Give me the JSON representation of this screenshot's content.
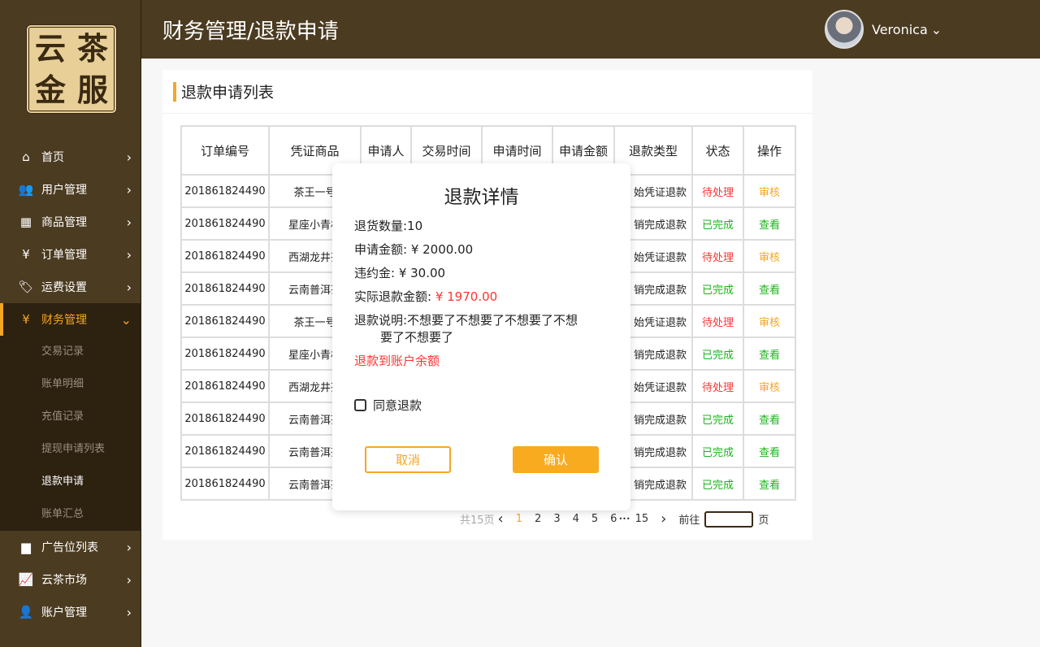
{
  "header": {
    "title": "财务管理/退款申请",
    "user": "Veronica"
  },
  "logo": [
    "云",
    "茶",
    "金",
    "服"
  ],
  "sidebar": {
    "items": [
      {
        "label": "首页",
        "icon": "home-icon",
        "glyph": "⌂"
      },
      {
        "label": "用户管理",
        "icon": "users-icon",
        "glyph": "👥"
      },
      {
        "label": "商品管理",
        "icon": "grid-icon",
        "glyph": "▦"
      },
      {
        "label": "订单管理",
        "icon": "yen-box-icon",
        "glyph": "¥"
      },
      {
        "label": "运费设置",
        "icon": "tag-icon",
        "glyph": "🏷"
      },
      {
        "label": "财务管理",
        "icon": "yen-box-icon",
        "glyph": "¥"
      }
    ],
    "sub": [
      "交易记录",
      "账单明细",
      "充值记录",
      "提现申请列表",
      "退款申请",
      "账单汇总"
    ],
    "items2": [
      {
        "label": "广告位列表",
        "icon": "shop-icon",
        "glyph": "▆"
      },
      {
        "label": "云茶市场",
        "icon": "chart-icon",
        "glyph": "📈"
      },
      {
        "label": "账户管理",
        "icon": "account-icon",
        "glyph": "👤"
      }
    ]
  },
  "card": {
    "title": "退款申请列表"
  },
  "table": {
    "headers": [
      "订单编号",
      "凭证商品",
      "申请人",
      "交易时间",
      "申请时间",
      "申请金额",
      "退款类型",
      "状态",
      "操作"
    ],
    "rows": [
      [
        "201861824490",
        "茶王一号",
        "始凭证退款",
        "待处理",
        "审核"
      ],
      [
        "201861824490",
        "星座小青柑",
        "销完成退款",
        "已完成",
        "查看"
      ],
      [
        "201861824490",
        "西湖龙井茶",
        "始凭证退款",
        "待处理",
        "审核"
      ],
      [
        "201861824490",
        "云南普洱茶",
        "销完成退款",
        "已完成",
        "查看"
      ],
      [
        "201861824490",
        "茶王一号",
        "始凭证退款",
        "待处理",
        "审核"
      ],
      [
        "201861824490",
        "星座小青柑",
        "销完成退款",
        "已完成",
        "查看"
      ],
      [
        "201861824490",
        "西湖龙井茶",
        "始凭证退款",
        "待处理",
        "审核"
      ],
      [
        "201861824490",
        "云南普洱茶",
        "销完成退款",
        "已完成",
        "查看"
      ],
      [
        "201861824490",
        "云南普洱茶",
        "销完成退款",
        "已完成",
        "查看"
      ],
      [
        "201861824490",
        "云南普洱茶",
        "销完成退款",
        "已完成",
        "查看"
      ]
    ]
  },
  "pager": {
    "total": "共15页",
    "prev": "‹",
    "pages": [
      "1",
      "2",
      "3",
      "4",
      "5",
      "6"
    ],
    "ellipsis": "•••",
    "last": "15",
    "next": "›",
    "goto": "前往",
    "unit": "页"
  },
  "modal": {
    "title": "退款详情",
    "qty": "退货数量:10",
    "amount": "申请金额: ¥ 2000.00",
    "penalty": "违约金: ¥ 30.00",
    "actual_label": "实际退款金额: ",
    "actual_value": "¥ 1970.00",
    "reason1": "退款说明:不想要了不想要了不想要了不想",
    "reason2": "要了不想要了",
    "dest": "退款到账户余额",
    "agree": "同意退款",
    "cancel": "取消",
    "confirm": "确认"
  }
}
